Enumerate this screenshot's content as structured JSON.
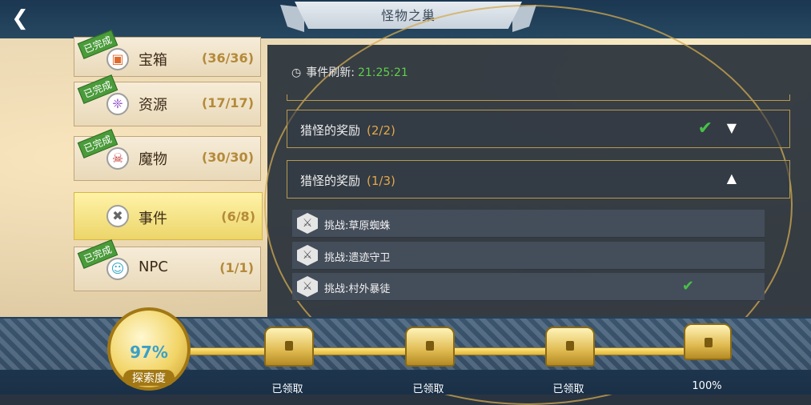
{
  "header": {
    "title": "怪物之巢",
    "back_icon": "back-arrow-icon"
  },
  "categories": [
    {
      "name": "宝箱",
      "count": "(36/36)",
      "done_label": "已完成",
      "icon": "chest-icon"
    },
    {
      "name": "资源",
      "count": "(17/17)",
      "done_label": "已完成",
      "icon": "crystal-icon"
    },
    {
      "name": "魔物",
      "count": "(30/30)",
      "done_label": "已完成",
      "icon": "monster-icon"
    },
    {
      "name": "事件",
      "count": "(6/8)",
      "done_label": "",
      "icon": "event-icon",
      "active": true
    },
    {
      "name": "NPC",
      "count": "(1/1)",
      "done_label": "已完成",
      "icon": "npc-icon"
    }
  ],
  "panel": {
    "refresh_label": "事件刷新:",
    "refresh_time": "21:25:21",
    "groups": [
      {
        "title": "猎怪的奖励",
        "count": "(2/2)",
        "completed": true,
        "expanded": false
      },
      {
        "title": "猎怪的奖励",
        "count": "(1/3)",
        "completed": false,
        "expanded": true
      }
    ],
    "tasks": [
      {
        "label": "挑战:草原蜘蛛",
        "done": false
      },
      {
        "label": "挑战:遗迹守卫",
        "done": false
      },
      {
        "label": "挑战:村外暴徒",
        "done": true
      }
    ]
  },
  "progress": {
    "percent": "97%",
    "label": "探索度",
    "milestones": [
      "已领取",
      "已领取",
      "已领取",
      "100%"
    ]
  },
  "colors": {
    "accent_gold": "#e0b63a",
    "check_green": "#48c048",
    "count_orange": "#e2a84a"
  }
}
